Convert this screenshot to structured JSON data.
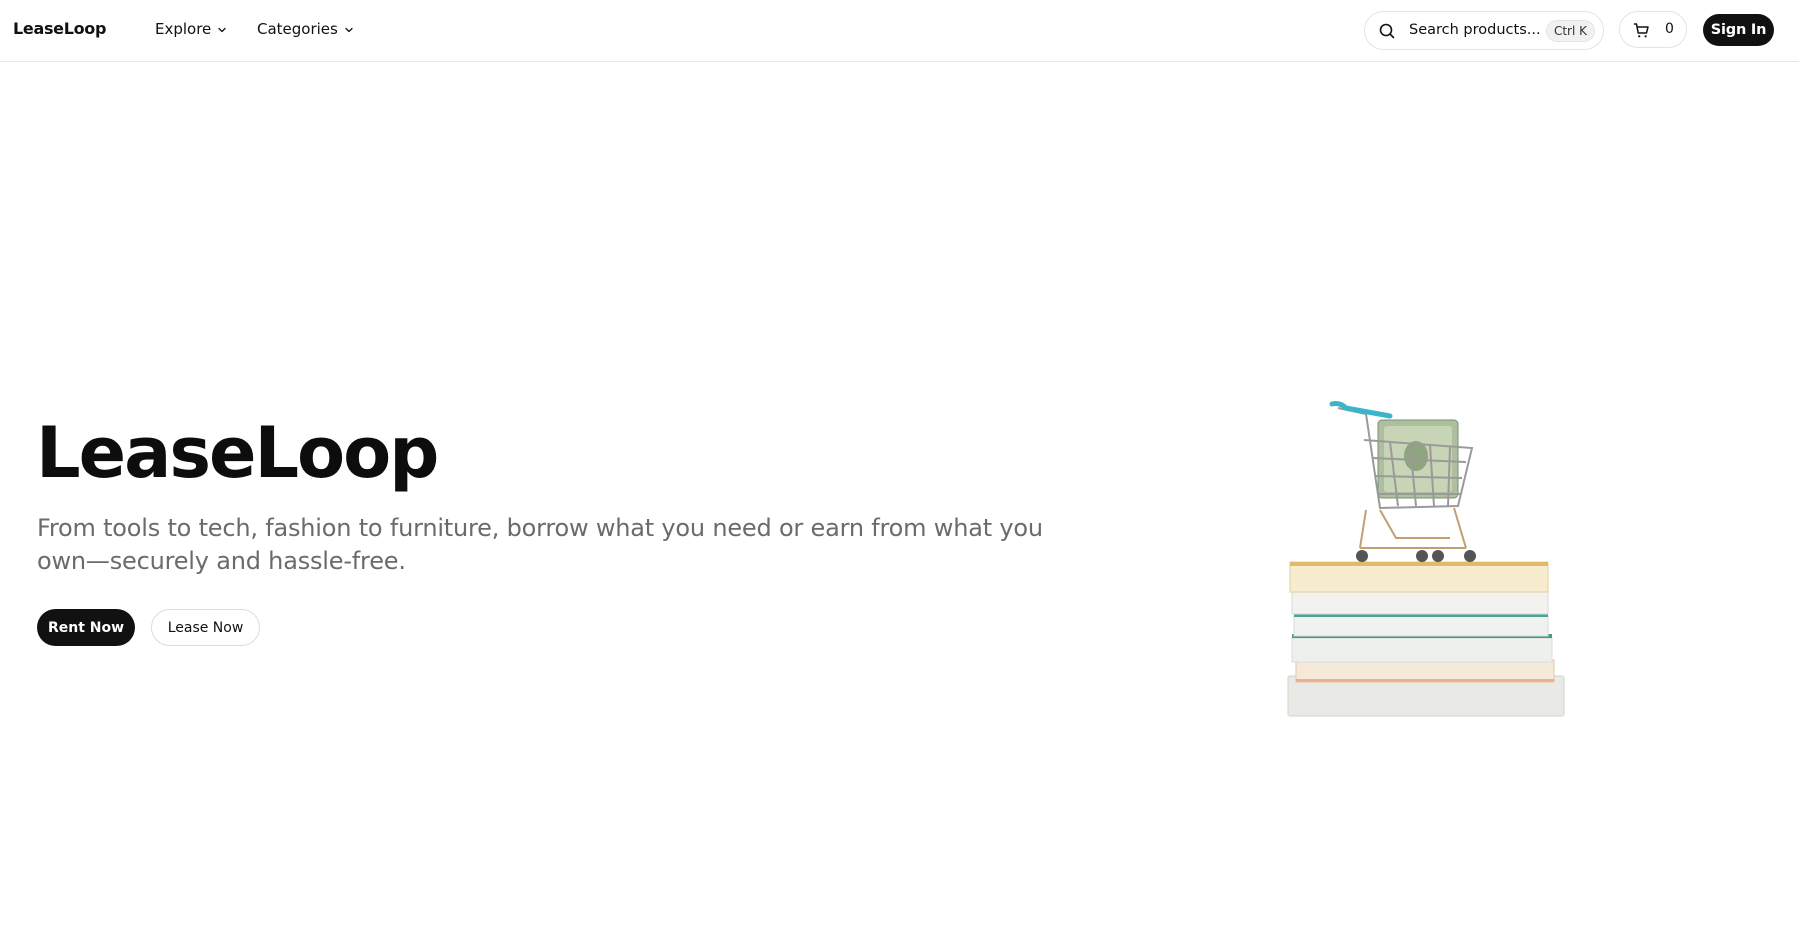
{
  "brand": {
    "name": "LeaseLoop"
  },
  "nav": {
    "explore_label": "Explore",
    "categories_label": "Categories"
  },
  "search": {
    "placeholder": "Search products...",
    "shortcut": "Ctrl K",
    "icon": "search-icon"
  },
  "cart": {
    "count": "0",
    "icon": "shopping-cart-icon"
  },
  "auth": {
    "signin_label": "Sign In"
  },
  "hero": {
    "title": "LeaseLoop",
    "subtitle": "From tools to tech, fashion to furniture, borrow what you need or earn from what you own—securely and hassle-free.",
    "primary_cta": "Rent Now",
    "secondary_cta": "Lease Now"
  },
  "colors": {
    "primary": "#111111",
    "subtitle_text": "#6b6b6b",
    "border": "#e3e3e3",
    "cart_handle": "#3bb6c9"
  }
}
